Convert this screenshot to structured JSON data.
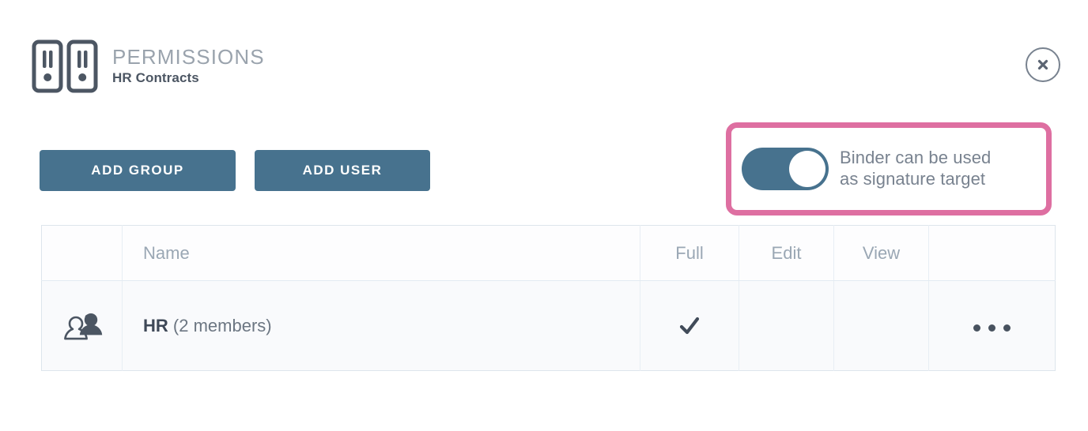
{
  "header": {
    "icon": "binders-icon",
    "title": "PERMISSIONS",
    "subtitle": "HR Contracts",
    "close_icon": "close-icon"
  },
  "toolbar": {
    "add_group_label": "ADD GROUP",
    "add_user_label": "ADD USER"
  },
  "signature_toggle": {
    "state": "on",
    "label_line1": "Binder can be used",
    "label_line2": "as signature target",
    "highlight_color": "#de6fa1",
    "accent_color": "#47728e"
  },
  "table": {
    "columns": {
      "icon": "",
      "name": "Name",
      "full": "Full",
      "edit": "Edit",
      "view": "View",
      "menu": ""
    },
    "rows": [
      {
        "icon": "group-icon",
        "name_primary": "HR",
        "name_secondary": "(2 members)",
        "full": "checked",
        "edit": "",
        "view": "",
        "menu_icon": "kebab-dots-icon"
      }
    ]
  },
  "colors": {
    "accent": "#47728e",
    "highlight": "#de6fa1",
    "text_dark": "#4c5663",
    "text_muted": "#9aa7b4",
    "border": "#dde5ec"
  }
}
